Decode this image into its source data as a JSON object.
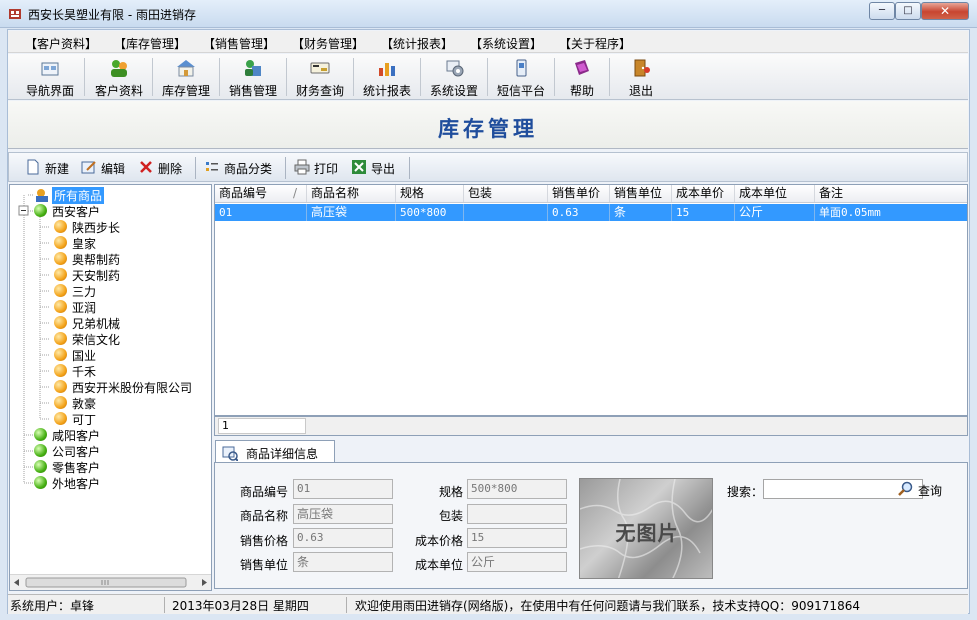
{
  "window": {
    "title": "西安长昊塑业有限 - 雨田进销存",
    "min": "─",
    "max": "□",
    "close": "✕"
  },
  "menu": [
    "【客户资料】",
    "【库存管理】",
    "【销售管理】",
    "【财务管理】",
    "【统计报表】",
    "【系统设置】",
    "【关于程序】"
  ],
  "toolbar": [
    {
      "label": "导航界面",
      "icon": "home-icon"
    },
    {
      "label": "客户资料",
      "icon": "customers-icon"
    },
    {
      "label": "库存管理",
      "icon": "warehouse-icon"
    },
    {
      "label": "销售管理",
      "icon": "sales-icon"
    },
    {
      "label": "财务查询",
      "icon": "finance-icon"
    },
    {
      "label": "统计报表",
      "icon": "chart-icon"
    },
    {
      "label": "系统设置",
      "icon": "settings-icon"
    },
    {
      "label": "短信平台",
      "icon": "sms-icon"
    },
    {
      "label": "帮助",
      "icon": "help-icon"
    },
    {
      "label": "退出",
      "icon": "exit-icon"
    }
  ],
  "page_title": "库存管理",
  "actions": {
    "new": "新建",
    "edit": "编辑",
    "delete": "删除",
    "category": "商品分类",
    "print": "打印",
    "export": "导出"
  },
  "tree": {
    "root": "所有商品",
    "groups": [
      {
        "label": "西安客户",
        "children": [
          "陕西步长",
          "皇家",
          "奥帮制药",
          "天安制药",
          "三力",
          "亚润",
          "兄弟机械",
          "荣信文化",
          "国业",
          "千禾",
          "西安开米股份有限公司",
          "敦豪",
          "可丁"
        ]
      },
      {
        "label": "咸阳客户"
      },
      {
        "label": "公司客户"
      },
      {
        "label": "零售客户"
      },
      {
        "label": "外地客户"
      }
    ]
  },
  "grid": {
    "columns": [
      "商品编号",
      "商品名称",
      "规格",
      "包装",
      "销售单价",
      "销售单位",
      "成本单价",
      "成本单位",
      "备注"
    ],
    "sort_indicator": "/",
    "rows": [
      [
        "01",
        "高压袋",
        "500*800",
        "",
        "0.63",
        "条",
        "15",
        "公斤",
        "单面0.05mm"
      ]
    ],
    "page": "1"
  },
  "detail": {
    "tab": "商品详细信息",
    "labels": {
      "code": "商品编号",
      "name": "商品名称",
      "price": "销售价格",
      "unit": "销售单位",
      "spec": "规格",
      "pack": "包装",
      "cost": "成本价格",
      "cost_unit": "成本单位"
    },
    "values": {
      "code": "01",
      "name": "高压袋",
      "price": "0.63",
      "unit": "条",
      "spec": "500*800",
      "pack": "",
      "cost": "15",
      "cost_unit": "公斤"
    },
    "photo": "无图片",
    "search_label": "搜索：",
    "search_value": "",
    "query": "查询"
  },
  "status": {
    "user": "系统用户：卓锋",
    "date": "2013年03月28日 星期四",
    "message": "欢迎使用雨田进销存(网络版)，在使用中有任何问题请与我们联系，技术支持QQ：909171864"
  },
  "colors": {
    "title_blue": "#1f4d9c",
    "selection": "#3399ff"
  }
}
